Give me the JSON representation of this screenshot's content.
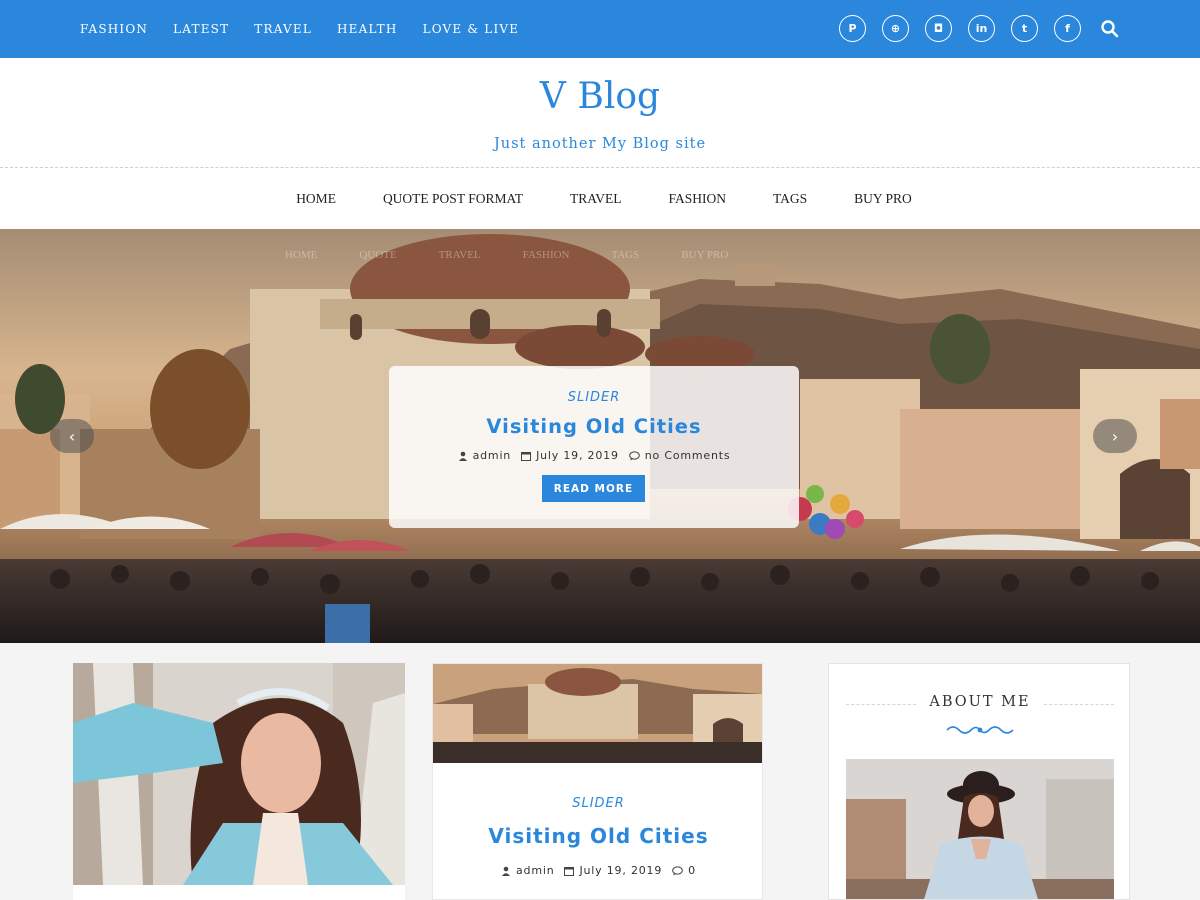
{
  "topbar": {
    "nav": [
      "FASHION",
      "LATEST",
      "TRAVEL",
      "HEALTH",
      "LOVE & LIVE"
    ],
    "socials": [
      {
        "icon": "pinterest-icon",
        "glyph": "P"
      },
      {
        "icon": "dribbble-icon",
        "glyph": "⊕"
      },
      {
        "icon": "instagram-icon",
        "glyph": "◘"
      },
      {
        "icon": "linkedin-icon",
        "glyph": "in"
      },
      {
        "icon": "twitter-icon",
        "glyph": "t"
      },
      {
        "icon": "facebook-icon",
        "glyph": "f"
      }
    ],
    "search_icon": "search-icon"
  },
  "header": {
    "site_title": "V Blog",
    "tagline": "Just another My Blog site"
  },
  "mainnav": [
    "HOME",
    "QUOTE POST FORMAT",
    "TRAVEL",
    "FASHION",
    "TAGS",
    "BUY PRO"
  ],
  "slider": {
    "ghost_nav": [
      "HOME",
      "QUOTE",
      "TRAVEL",
      "FASHION",
      "TAGS",
      "BUY PRO"
    ],
    "category": "SLIDER",
    "title": "Visiting Old Cities",
    "author": "admin",
    "date": "July 19, 2019",
    "comments": "no Comments",
    "read_more": "READ MORE",
    "prev_glyph": "‹",
    "next_glyph": "›"
  },
  "posts": [
    {
      "image": "woman-portrait"
    },
    {
      "category": "SLIDER",
      "title": "Visiting Old Cities",
      "author": "admin",
      "date": "July 19, 2019",
      "comments": "0"
    }
  ],
  "sidebar": {
    "widget_title": "ABOUT ME"
  },
  "colors": {
    "accent": "#2a87dc",
    "background": "#f4f4f4"
  }
}
